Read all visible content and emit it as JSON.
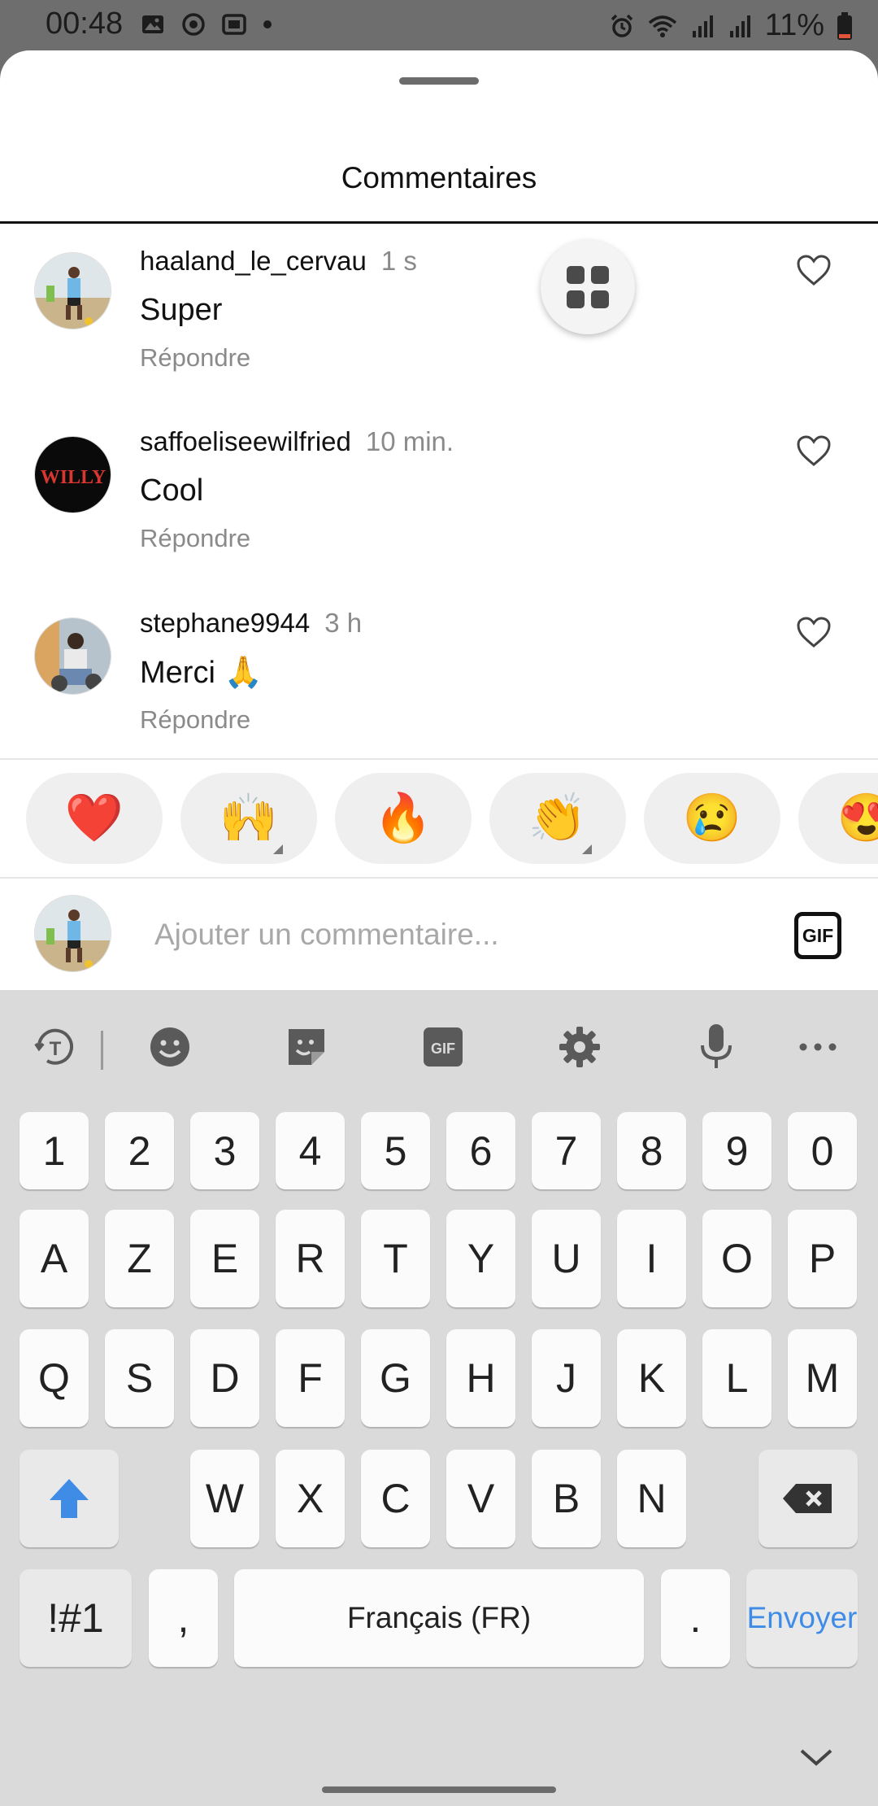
{
  "status_bar": {
    "time": "00:48",
    "battery": "11%",
    "icons_left": [
      "image-icon",
      "sync-icon",
      "cast-icon",
      "dot-icon"
    ],
    "icons_right": [
      "alarm-icon",
      "wifi-icon",
      "signal-icon",
      "signal-icon",
      "battery-icon"
    ]
  },
  "sheet": {
    "title": "Commentaires"
  },
  "comments": [
    {
      "user": "haaland_le_cervau",
      "time": "1 s",
      "text": "Super",
      "reply": "Répondre"
    },
    {
      "user": "saffoeliseewilfried",
      "time": "10 min.",
      "text": "Cool",
      "reply": "Répondre",
      "avatar_text": "WILLY"
    },
    {
      "user": "stephane9944",
      "time": "3 h",
      "text": "Merci 🙏",
      "reply": "Répondre"
    }
  ],
  "emoji_reactions": [
    "❤️",
    "🙌",
    "🔥",
    "👏",
    "😢",
    "😍"
  ],
  "comment_input": {
    "placeholder": "Ajouter un commentaire...",
    "gif_label": "GIF"
  },
  "keyboard": {
    "toolbar": [
      "text-style-icon",
      "emoji-icon",
      "sticker-icon",
      "gif-icon",
      "settings-icon",
      "microphone-icon",
      "more-icon"
    ],
    "gif_tool_label": "GIF",
    "row_numbers": [
      "1",
      "2",
      "3",
      "4",
      "5",
      "6",
      "7",
      "8",
      "9",
      "0"
    ],
    "row1": [
      "A",
      "Z",
      "E",
      "R",
      "T",
      "Y",
      "U",
      "I",
      "O",
      "P"
    ],
    "row2": [
      "Q",
      "S",
      "D",
      "F",
      "G",
      "H",
      "J",
      "K",
      "L",
      "M"
    ],
    "row3": [
      "W",
      "X",
      "C",
      "V",
      "B",
      "N"
    ],
    "symbols_key": "!#1",
    "comma_key": ",",
    "space_key": "Français (FR)",
    "period_key": ".",
    "send_key": "Envoyer"
  },
  "colors": {
    "accent_blue": "#3f8ce6",
    "status_bar_bg": "#6e6e6e",
    "keyboard_bg": "#dadada",
    "secondary_text": "#8a8a8a"
  }
}
